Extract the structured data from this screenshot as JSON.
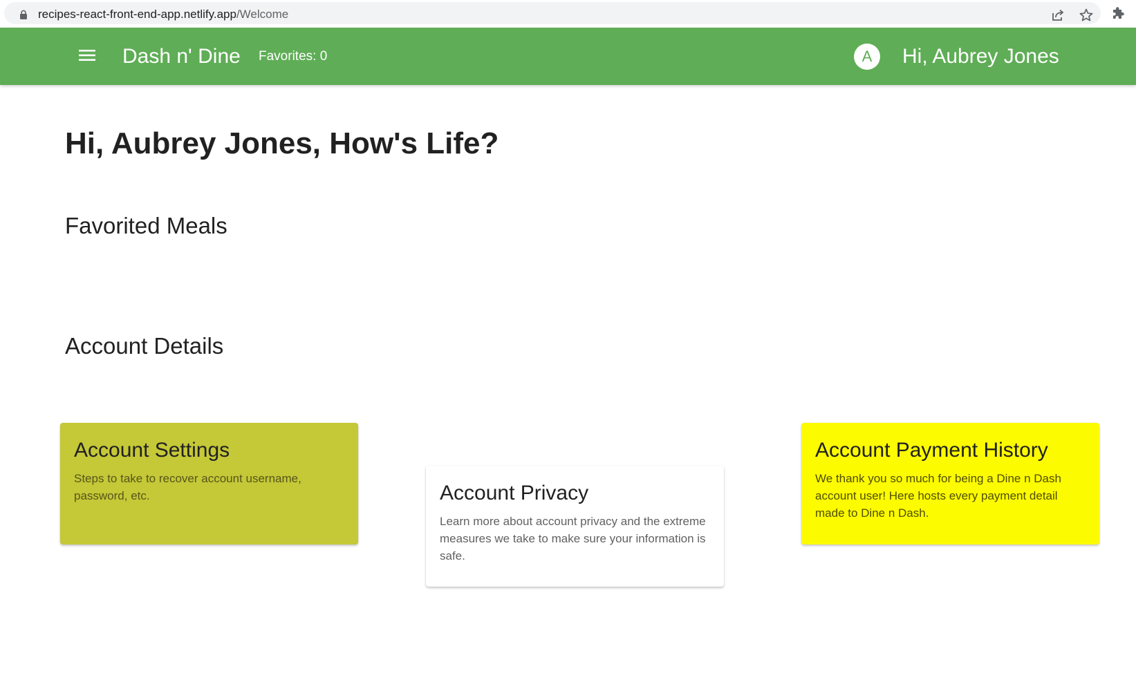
{
  "browser": {
    "url_host": "recipes-react-front-end-app.netlify.app",
    "url_path": "/Welcome",
    "icons": [
      "lock-icon",
      "share-icon",
      "star-icon",
      "extensions-icon"
    ]
  },
  "header": {
    "menu_icon": "hamburger-menu-icon",
    "brand": "Dash n' Dine",
    "favorites": "Favorites: 0",
    "avatar_initial": "A",
    "greeting": "Hi, Aubrey Jones",
    "background_color": "#5fad56"
  },
  "main": {
    "title": "Hi, Aubrey Jones, How's Life?",
    "favorited_heading": "Favorited Meals",
    "account_heading": "Account Details",
    "cards": [
      {
        "title": "Account Settings",
        "body": "Steps to take to recover account username, password, etc.",
        "color": "#c5c837"
      },
      {
        "title": "Account Privacy",
        "body": "Learn more about account privacy and the extreme measures we take to make sure your information is safe.",
        "color": "#ffffff"
      },
      {
        "title": "Account Payment History",
        "body": "We thank you so much for being a Dine n Dash account user! Here hosts every payment detail made to Dine n Dash.",
        "color": "#fdfb00"
      }
    ]
  }
}
